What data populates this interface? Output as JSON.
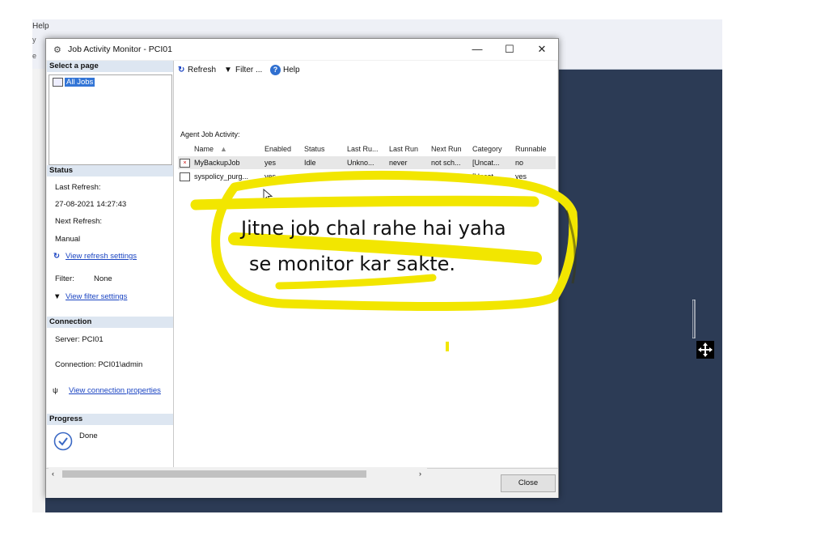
{
  "app_menu": {
    "help_label": "Help"
  },
  "dialog": {
    "title": "Job Activity Monitor - PCI01",
    "window_controls": {
      "minimize": "—",
      "maximize": "☐",
      "close": "✕"
    },
    "toolbar": {
      "refresh": "Refresh",
      "filter": "Filter ...",
      "help": "Help"
    },
    "left": {
      "select_page_header": "Select a page",
      "pages": [
        "All Jobs"
      ],
      "status_header": "Status",
      "last_refresh_label": "Last Refresh:",
      "last_refresh_value": "27-08-2021 14:27:43",
      "next_refresh_label": "Next Refresh:",
      "next_refresh_value": "Manual",
      "refresh_settings_link": "View refresh settings",
      "filter_label": "Filter:",
      "filter_value": "None",
      "filter_settings_link": "View filter settings",
      "connection_header": "Connection",
      "server": "Server: PCI01",
      "connection": "Connection: PCI01\\admin",
      "connection_link": "View connection properties",
      "progress_header": "Progress",
      "progress_status": "Done"
    },
    "grid": {
      "caption": "Agent Job Activity:",
      "columns": [
        "Name",
        "Enabled",
        "Status",
        "Last Ru...",
        "Last Run",
        "Next Run",
        "Category",
        "Runnable"
      ],
      "rows": [
        [
          "MyBackupJob",
          "yes",
          "Idle",
          "Unkno...",
          "never",
          "not sch...",
          "[Uncat...",
          "no"
        ],
        [
          "syspolicy_purg...",
          "yes",
          "Idle",
          "Unkno...",
          "never",
          "28-08-...",
          "[Uncat...",
          "yes"
        ]
      ]
    },
    "close_button": "Close"
  },
  "annotation": {
    "line1": "Jitne job chal rahe hai yaha",
    "line2": "se monitor kar sakte.",
    "highlight_color": "#f2e600"
  },
  "colors": {
    "background": "#2c3b55",
    "section_header": "#dde6f1",
    "selection": "#3375d6",
    "link": "#1a44c2"
  }
}
